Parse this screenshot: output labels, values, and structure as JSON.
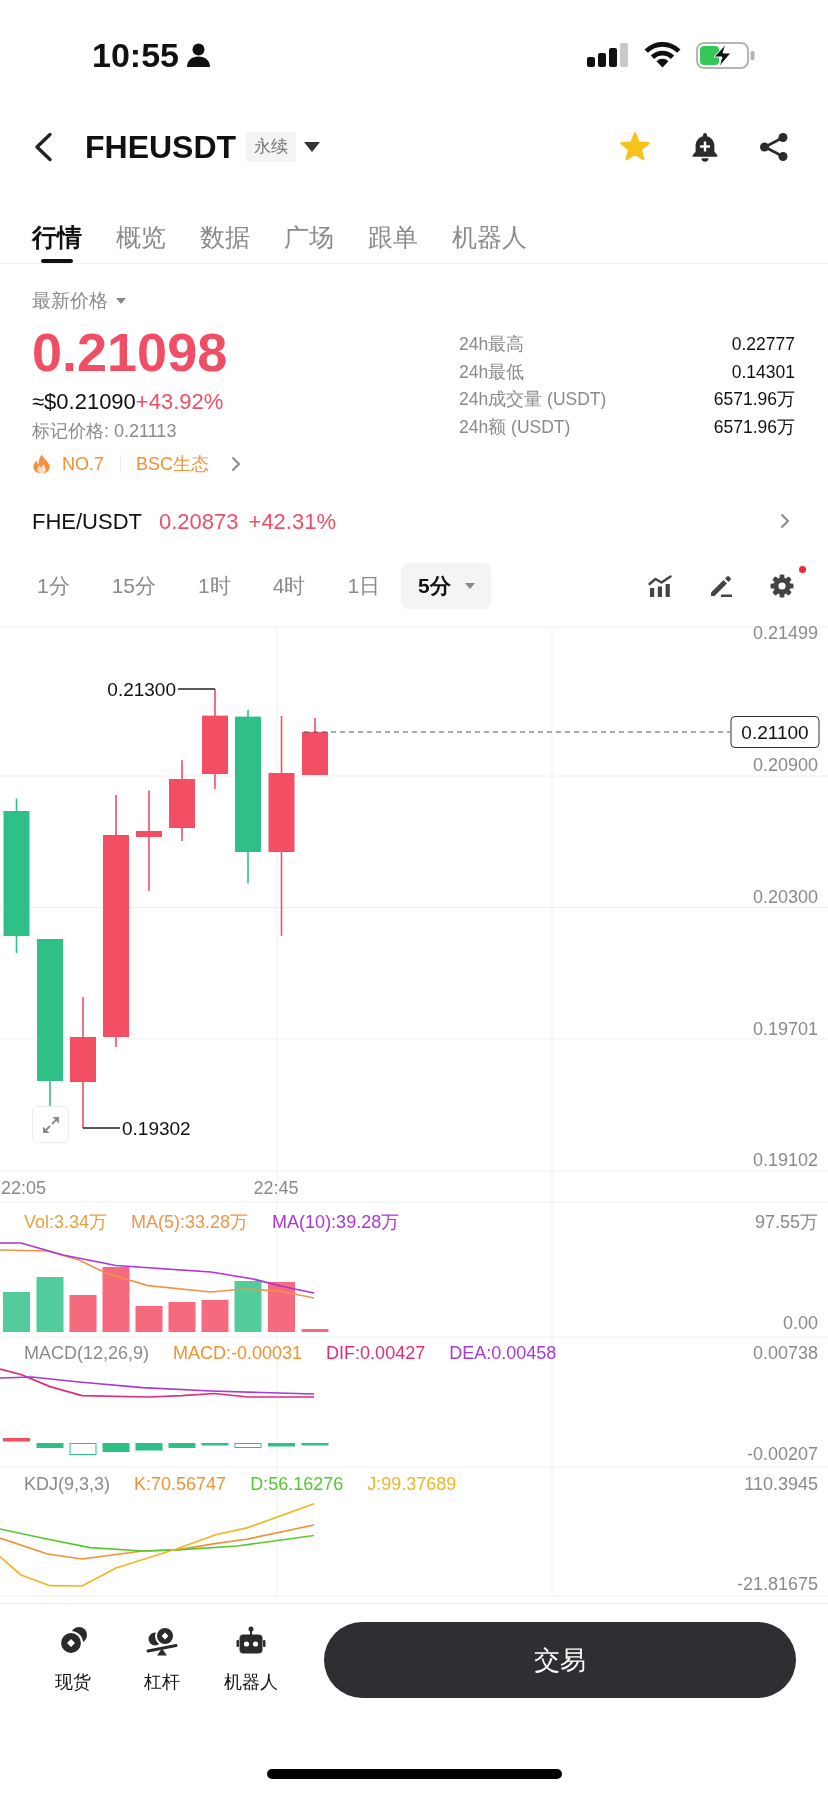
{
  "status_bar": {
    "time": "10:55"
  },
  "header": {
    "symbol": "FHEUSDT",
    "contract_type": "永续",
    "favorited": true
  },
  "tabs": [
    {
      "label": "行情",
      "selected": true
    },
    {
      "label": "概览",
      "selected": false
    },
    {
      "label": "数据",
      "selected": false
    },
    {
      "label": "广场",
      "selected": false
    },
    {
      "label": "跟单",
      "selected": false
    },
    {
      "label": "机器人",
      "selected": false
    }
  ],
  "price_panel": {
    "label": "最新价格",
    "last_price": "0.21098",
    "usd_price": "≈$0.21090",
    "change": "+43.92%",
    "mark_price": "标记价格: 0.21113",
    "rank": "NO.7",
    "tag": "BSC生态",
    "stats": [
      {
        "label": "24h最高",
        "value": "0.22777"
      },
      {
        "label": "24h最低",
        "value": "0.14301"
      },
      {
        "label": "24h成交量 (USDT)",
        "value": "6571.96万"
      },
      {
        "label": "24h额 (USDT)",
        "value": "6571.96万"
      }
    ]
  },
  "spot_pair": {
    "symbol": "FHE/USDT",
    "price": "0.20873",
    "change": "+42.31%"
  },
  "intervals": [
    {
      "label": "1分",
      "selected": false
    },
    {
      "label": "15分",
      "selected": false
    },
    {
      "label": "1时",
      "selected": false
    },
    {
      "label": "4时",
      "selected": false
    },
    {
      "label": "1日",
      "selected": false
    },
    {
      "label": "5分",
      "selected": true
    }
  ],
  "toolbar": {
    "settings_badge": true
  },
  "chart": {
    "price_axis": [
      "0.21499",
      "0.20900",
      "0.20300",
      "0.19701",
      "0.19102"
    ],
    "high_label": "0.21300",
    "low_label": "0.19302",
    "current_price": "0.21100",
    "time_axis": [
      "22:05",
      "22:45"
    ]
  },
  "volume": {
    "legend": [
      {
        "text": "Vol:3.34万",
        "color": "#e8a03c"
      },
      {
        "text": "MA(5):33.28万",
        "color": "#f0944c"
      },
      {
        "text": "MA(10):39.28万",
        "color": "#b034d4"
      }
    ],
    "axis": [
      "97.55万",
      "0.00"
    ]
  },
  "macd": {
    "legend": [
      {
        "text": "MACD(12,26,9)",
        "color": "#8a8a8a"
      },
      {
        "text": "MACD:-0.00031",
        "color": "#f0922e"
      },
      {
        "text": "DIF:0.00427",
        "color": "#e02c7a"
      },
      {
        "text": "DEA:0.00458",
        "color": "#a63ad8"
      }
    ],
    "axis": [
      "0.00738",
      "-0.00207"
    ]
  },
  "kdj": {
    "legend": [
      {
        "text": "KDJ(9,3,3)",
        "color": "#8a8a8a"
      },
      {
        "text": "K:70.56747",
        "color": "#ef9235"
      },
      {
        "text": "D:56.16276",
        "color": "#56c82c"
      },
      {
        "text": "J:99.37689",
        "color": "#f0b522"
      }
    ],
    "axis": [
      "110.3945",
      "-21.81675"
    ]
  },
  "bottom_nav": [
    {
      "kind": "coins",
      "label": "现货"
    },
    {
      "kind": "seesaw",
      "label": "杠杆"
    },
    {
      "kind": "robot",
      "label": "机器人"
    }
  ],
  "trade_button": {
    "label": "交易"
  }
}
